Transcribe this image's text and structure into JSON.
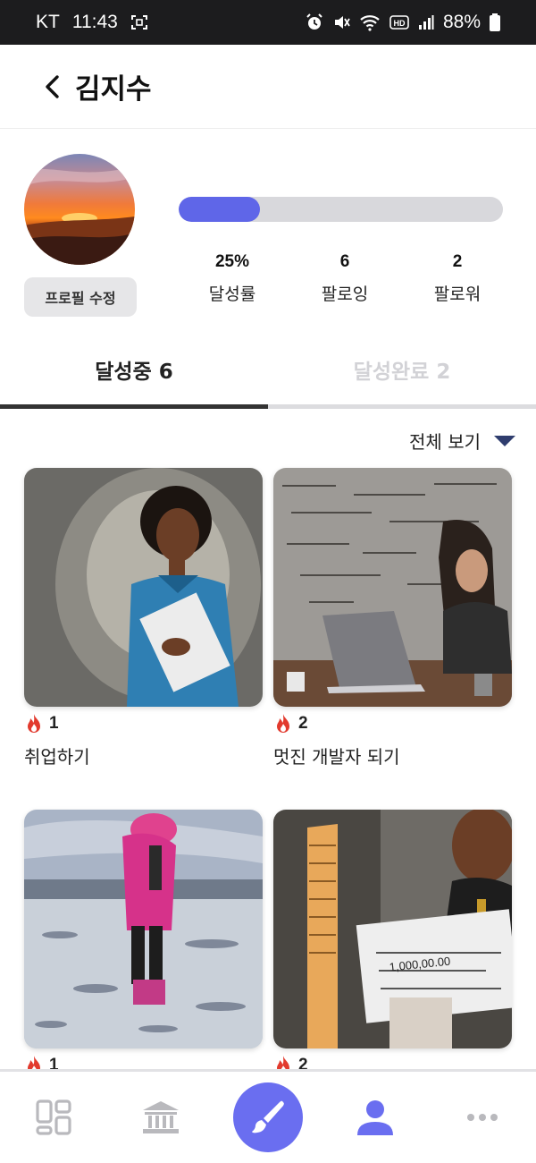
{
  "status_bar": {
    "carrier": "KT",
    "time": "11:43",
    "battery": "88%"
  },
  "header": {
    "title": "김지수"
  },
  "profile": {
    "edit_label": "프로필 수정",
    "progress_fraction": 0.25,
    "stats": [
      {
        "value": "25%",
        "label": "달성률"
      },
      {
        "value": "6",
        "label": "팔로잉"
      },
      {
        "value": "2",
        "label": "팔로워"
      }
    ]
  },
  "tabs": [
    {
      "label": "달성중 6",
      "active": true
    },
    {
      "label": "달성완료 2",
      "active": false
    }
  ],
  "filter": {
    "label": "전체 보기"
  },
  "goals": [
    {
      "count": "1",
      "title": "취업하기"
    },
    {
      "count": "2",
      "title": "멋진 개발자 되기"
    },
    {
      "count": "1",
      "title": ""
    },
    {
      "count": "2",
      "title": ""
    }
  ],
  "colors": {
    "accent": "#5f66e8",
    "fire": "#e23a2e",
    "nav_icon": "#b9b9bd",
    "nav_active": "#6a6ef0"
  },
  "bottom_nav": {
    "icons": [
      "dashboard-icon",
      "bank-icon",
      "brush-icon",
      "person-icon",
      "more-icon"
    ]
  }
}
